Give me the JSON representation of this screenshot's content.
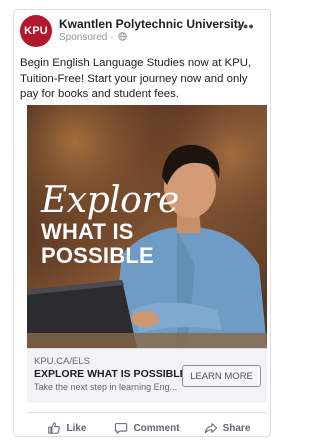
{
  "post": {
    "page_name": "Kwantlen Polytechnic University",
    "avatar_text": "KPU",
    "sponsored": "Sponsored",
    "separator": " · ",
    "primary_text": "Begin English Language Studies now at KPU, Tuition-Free! Start your journey now and only pay for books and student fees.",
    "more_label": "•••"
  },
  "image": {
    "script_word": "Explore",
    "line2": "WHAT IS",
    "line3": "POSSIBLE"
  },
  "link": {
    "domain": "KPU.CA/ELS",
    "title": "EXPLORE WHAT IS POSSIBLE",
    "description": "Take the next step in learning Eng...",
    "cta": "LEARN MORE"
  },
  "actions": {
    "like": "Like",
    "comment": "Comment",
    "share": "Share"
  },
  "colors": {
    "brand": "#b1182e",
    "text": "#1c1e21",
    "secondary": "#606770"
  },
  "icons": {
    "globe": "globe-icon",
    "more": "more-icon",
    "like": "thumbs-up-icon",
    "comment": "comment-icon",
    "share": "share-icon"
  }
}
